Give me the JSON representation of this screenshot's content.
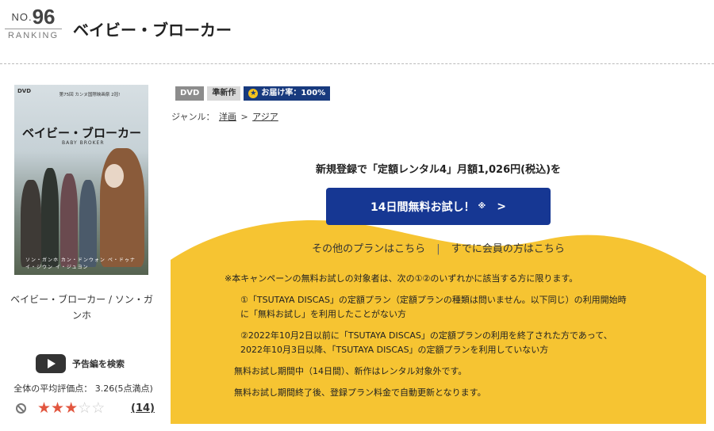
{
  "header": {
    "rank_no": "NO.",
    "rank_num": "96",
    "rank_label": "RANKING",
    "title": "ベイビー・ブローカー"
  },
  "poster": {
    "dvd": "DVD",
    "festival": "第75回 カンヌ国際映画祭 2冠!",
    "title": "ベイビー・ブローカー",
    "subtitle": "BABY BROKER",
    "credits": "ソン・ガンホ カン・ドンウォン ペ・ドゥナ イ・ジウン イ・ジュヨン"
  },
  "poster_caption": "ベイビー・ブローカー / ソン・ガンホ",
  "trailer": {
    "label": "予告編を検索",
    "icon": "youtube-play-icon"
  },
  "rating": {
    "label": "全体の平均評価点：",
    "value": "3.26(5点満点)",
    "stars_filled": 3,
    "stars_total": 5,
    "count": "(14)"
  },
  "badges": {
    "dvd": "DVD",
    "new": "準新作",
    "delivery": "お届け率：100%"
  },
  "genre": {
    "label": "ジャンル：",
    "link1": "洋画",
    "sep": ">",
    "link2": "アジア"
  },
  "promo": {
    "text": "新規登録で「定額レンタル4」月額1,026円(税込)を",
    "button_label": "14日間無料お試し！",
    "button_mark": "※",
    "button_chevron": ">"
  },
  "plan_links": {
    "other": "その他のプランはこちら",
    "sep": "|",
    "member": "すでに会員の方はこちら"
  },
  "notes": {
    "n1": "※本キャンペーンの無料お試しの対象者は、次の①②のいずれかに該当する方に限ります。",
    "n2a": "①「TSUTAYA DISCAS」の定額プラン（定額プランの種類は問いません。以下同じ）の利用開始時",
    "n2b": "に「無料お試し」を利用したことがない方",
    "n3a": "②2022年10月2日以前に「TSUTAYA DISCAS」の定額プランの利用を終了された方であって、",
    "n3b": "2022年10月3日以降、「TSUTAYA DISCAS」の定額プランを利用していない方",
    "n4": "無料お試し期間中（14日間）、新作はレンタル対象外です。",
    "n5": "無料お試し期間終了後、登録プラン料金で自動更新となります。"
  },
  "colors": {
    "accent_blue": "#163793",
    "yellow": "#f6c432",
    "star": "#e2563f"
  }
}
